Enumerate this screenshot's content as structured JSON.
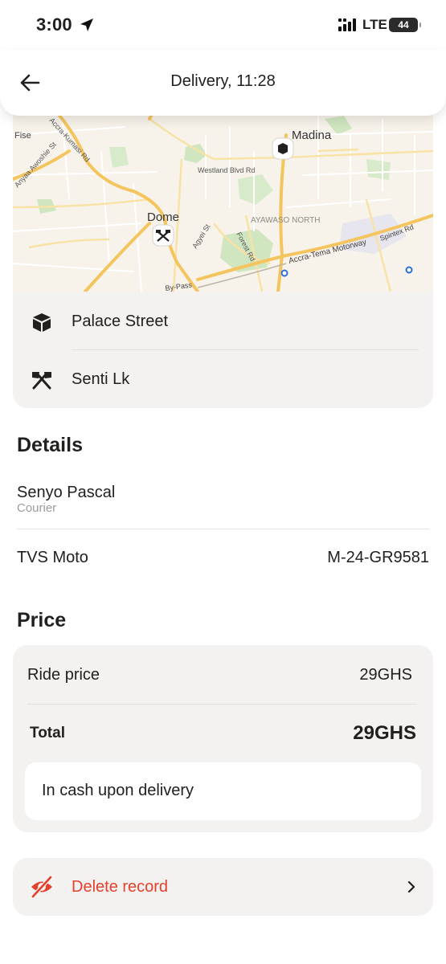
{
  "status_bar": {
    "time": "3:00",
    "network": "LTE",
    "battery": "44"
  },
  "header": {
    "title": "Delivery, 11:28",
    "back_icon": "arrow-left-icon"
  },
  "map": {
    "labels": {
      "madina": "Madina",
      "dome": "Dome",
      "fise": "Fise",
      "ayawaso_north": "AYAWASO NORTH",
      "westland": "Westland Blvd Rd",
      "accra_kumasi": "Accra-Kumasi Rd",
      "anyaa_awoshie": "Anyaa Awoshie St",
      "agyei": "Agyei St",
      "forest": "Forest Rd",
      "accra_tema": "Accra-Tema Motorway",
      "spintex": "Spintex Rd",
      "bypass": "By-Pass"
    },
    "colors": {
      "land": "#f7f3ea",
      "park": "#cfe6c0",
      "major_road": "#f4c55e",
      "minor_road": "#f8e2a6",
      "street": "#ffffff"
    }
  },
  "route": {
    "pickup": {
      "label": "Palace Street",
      "icon": "package-box-icon"
    },
    "destination": {
      "label": "Senti Lk",
      "icon": "crossed-flags-icon"
    }
  },
  "details": {
    "title": "Details",
    "courier_name": "Senyo Pascal",
    "courier_role": "Courier",
    "vehicle": "TVS Moto",
    "plate": "M-24-GR9581"
  },
  "price": {
    "title": "Price",
    "ride_price_label": "Ride price",
    "ride_price_value": "29GHS",
    "total_label": "Total",
    "total_value": "29GHS",
    "payment_method": "In cash upon delivery"
  },
  "actions": {
    "delete_label": "Delete record",
    "delete_icon": "eye-off-icon",
    "delete_color": "#e4402c"
  }
}
